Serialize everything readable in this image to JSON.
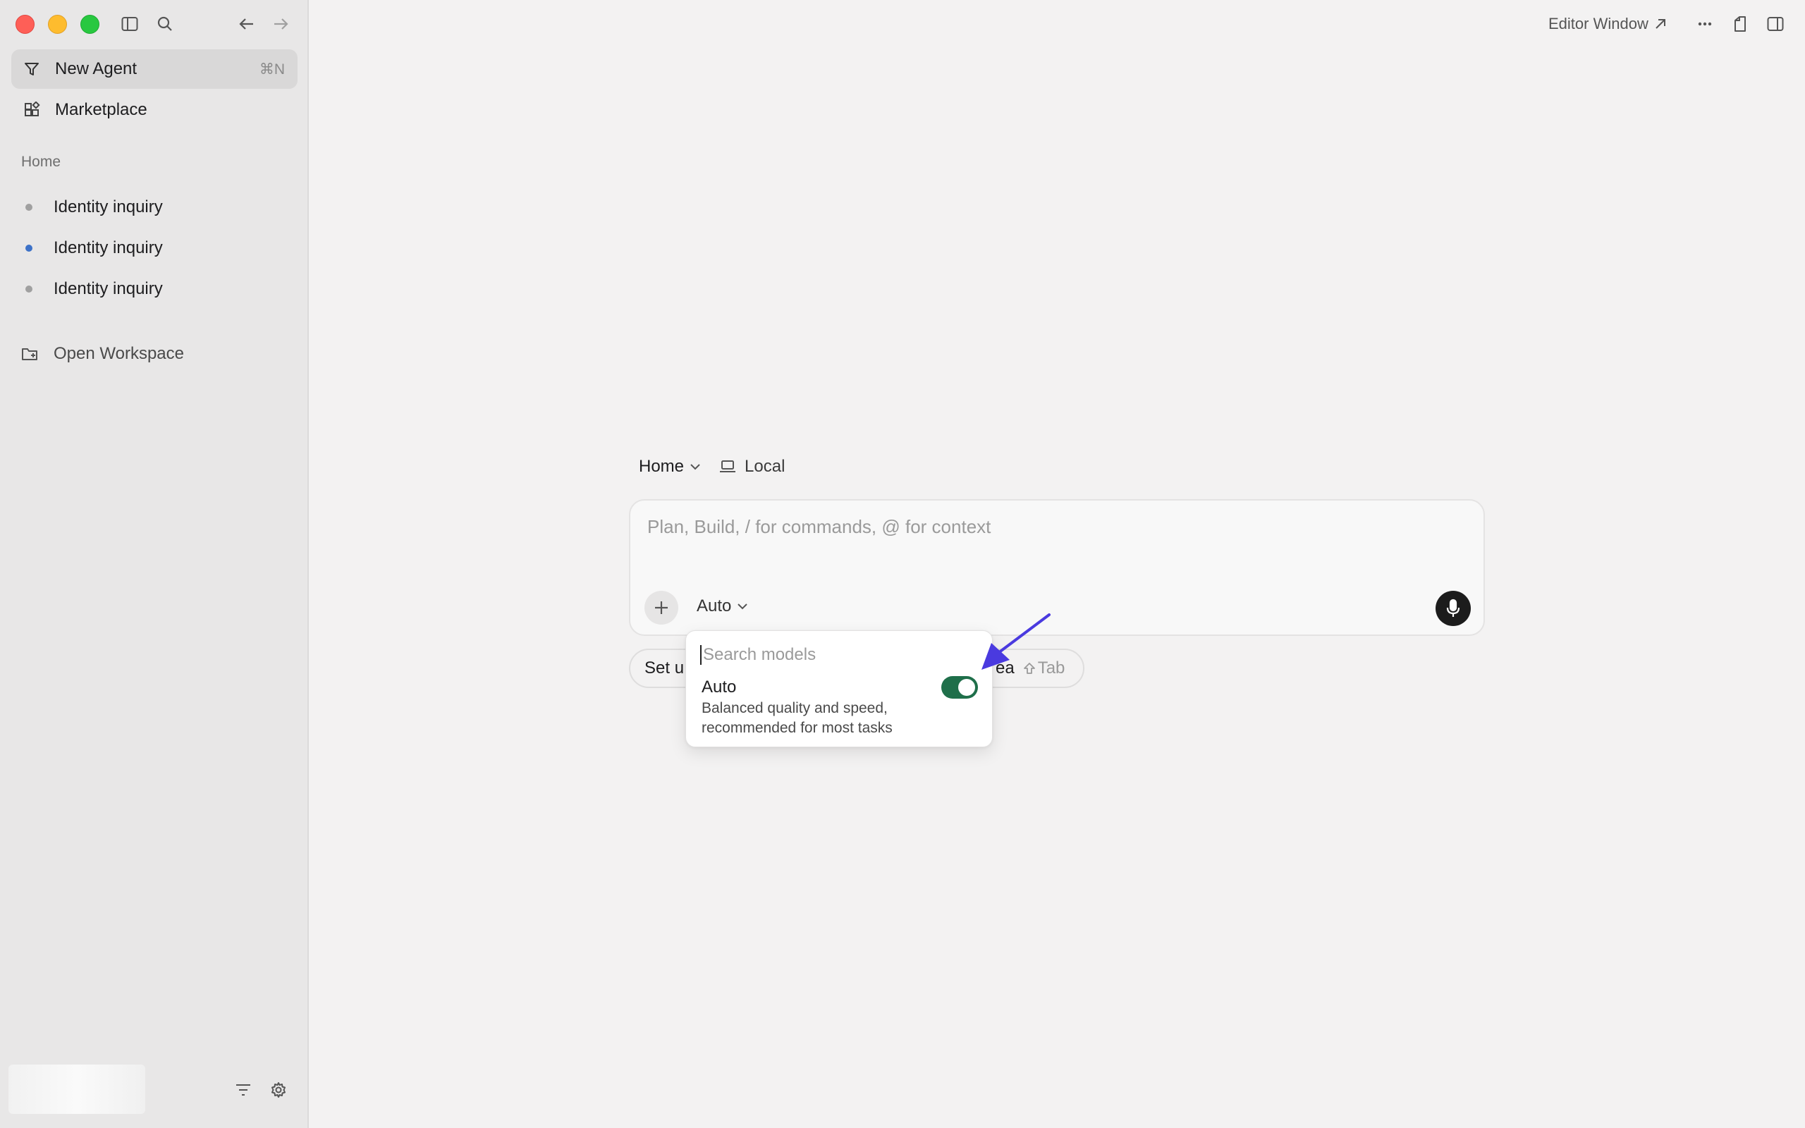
{
  "sidebar": {
    "window_controls": {
      "close": "close",
      "minimize": "minimize",
      "zoom": "zoom"
    },
    "toolbar_icons": [
      "sidebar-toggle-icon",
      "search-icon",
      "back-arrow-icon",
      "forward-arrow-icon"
    ],
    "new_agent": {
      "label": "New Agent",
      "shortcut": "⌘N",
      "icon": "agent-icon"
    },
    "marketplace": {
      "label": "Marketplace",
      "icon": "marketplace-icon"
    },
    "section_label": "Home",
    "history": [
      {
        "label": "Identity inquiry",
        "status_color": "#a0a0a0"
      },
      {
        "label": "Identity inquiry",
        "status_color": "#3d72c8"
      },
      {
        "label": "Identity inquiry",
        "status_color": "#a0a0a0"
      }
    ],
    "open_workspace": {
      "label": "Open Workspace",
      "icon": "folder-plus-icon"
    },
    "bottom_icons": [
      "filter-icon",
      "gear-icon"
    ]
  },
  "header": {
    "editor_window": {
      "label": "Editor Window",
      "icon": "external-arrow-icon"
    },
    "icons": [
      "more-icon",
      "document-icon",
      "right-panel-icon"
    ]
  },
  "composer": {
    "context": {
      "workspace": "Home",
      "location": "Local"
    },
    "input": {
      "value": "",
      "placeholder": "Plan, Build, / for commands, @ for context"
    },
    "model": "Auto",
    "mic_icon": "microphone-icon"
  },
  "suggestions": {
    "left_text": "Set u",
    "right_text": "ea",
    "tab_hint": "Tab"
  },
  "model_dropdown": {
    "search": {
      "value": "",
      "placeholder": "Search models"
    },
    "option": {
      "title": "Auto",
      "description": "Balanced quality and speed, recommended for most tasks",
      "enabled": true
    },
    "toggle_color": "#1f6f4a"
  },
  "annotation": {
    "arrow_color": "#4a3adf"
  }
}
